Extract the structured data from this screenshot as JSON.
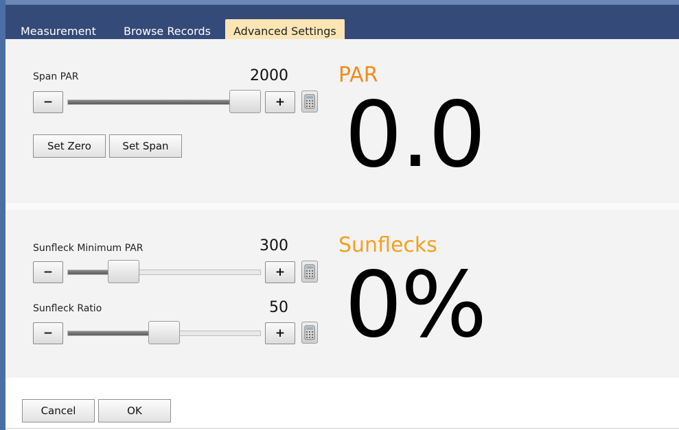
{
  "tabs": [
    {
      "label": "Measurement",
      "active": false
    },
    {
      "label": "Browse Records",
      "active": false
    },
    {
      "label": "Advanced Settings",
      "active": true
    }
  ],
  "span_par": {
    "label": "Span PAR",
    "value": "2000",
    "slider_fraction": 1.0,
    "minus": "−",
    "plus": "+",
    "set_zero": "Set Zero",
    "set_span": "Set Span"
  },
  "par_readout": {
    "title": "PAR",
    "value": "0.0"
  },
  "sunfleck_min": {
    "label": "Sunfleck Minimum PAR",
    "value": "300",
    "slider_fraction": 0.25,
    "minus": "−",
    "plus": "+"
  },
  "sunfleck_ratio": {
    "label": "Sunfleck Ratio",
    "value": "50",
    "slider_fraction": 0.5,
    "minus": "−",
    "plus": "+"
  },
  "sunflecks_readout": {
    "title": "Sunflecks",
    "value": "0%"
  },
  "footer": {
    "cancel": "Cancel",
    "ok": "OK"
  },
  "colors": {
    "accent_title": "#f08c1e",
    "tabbar": "#344a78",
    "active_tab": "#fce5b4"
  }
}
